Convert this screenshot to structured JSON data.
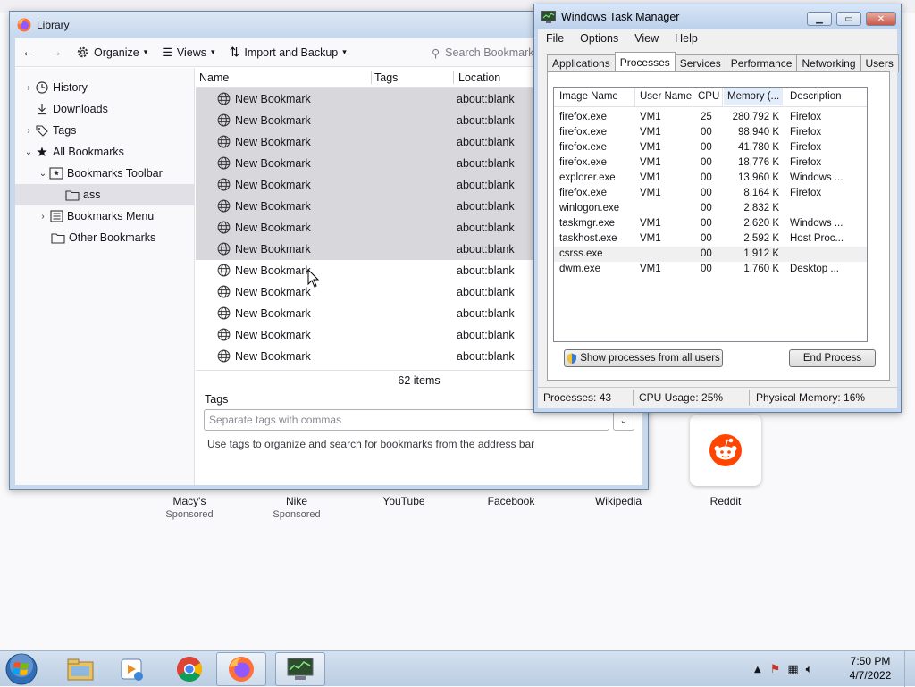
{
  "library": {
    "title": "Library",
    "toolbar": {
      "organize": "Organize",
      "views": "Views",
      "import_backup": "Import and Backup",
      "search_placeholder": "Search Bookmarks"
    },
    "sidebar": [
      {
        "label": "History",
        "twisty": "›",
        "icon": "clock-icon"
      },
      {
        "label": "Downloads",
        "twisty": "",
        "icon": "download-icon"
      },
      {
        "label": "Tags",
        "twisty": "›",
        "icon": "tags-icon"
      },
      {
        "label": "All Bookmarks",
        "twisty": "⌄",
        "icon": "star-icon"
      },
      {
        "label": "Bookmarks Toolbar",
        "twisty": "⌄",
        "icon": "bookmarks-toolbar-icon"
      },
      {
        "label": "ass",
        "twisty": "",
        "icon": "folder-icon"
      },
      {
        "label": "Bookmarks Menu",
        "twisty": "›",
        "icon": "bookmarks-menu-icon"
      },
      {
        "label": "Other Bookmarks",
        "twisty": "",
        "icon": "folder-icon"
      }
    ],
    "columns": {
      "name": "Name",
      "tags": "Tags",
      "location": "Location"
    },
    "bookmarks": [
      {
        "name": "New Bookmark",
        "location": "about:blank",
        "selected": true
      },
      {
        "name": "New Bookmark",
        "location": "about:blank",
        "selected": true
      },
      {
        "name": "New Bookmark",
        "location": "about:blank",
        "selected": true
      },
      {
        "name": "New Bookmark",
        "location": "about:blank",
        "selected": true
      },
      {
        "name": "New Bookmark",
        "location": "about:blank",
        "selected": true
      },
      {
        "name": "New Bookmark",
        "location": "about:blank",
        "selected": true
      },
      {
        "name": "New Bookmark",
        "location": "about:blank",
        "selected": true
      },
      {
        "name": "New Bookmark",
        "location": "about:blank",
        "selected": true
      },
      {
        "name": "New Bookmark",
        "location": "about:blank",
        "selected": false
      },
      {
        "name": "New Bookmark",
        "location": "about:blank",
        "selected": false
      },
      {
        "name": "New Bookmark",
        "location": "about:blank",
        "selected": false
      },
      {
        "name": "New Bookmark",
        "location": "about:blank",
        "selected": false
      },
      {
        "name": "New Bookmark",
        "location": "about:blank",
        "selected": false
      }
    ],
    "items_count": "62 items",
    "tags_label": "Tags",
    "tags_placeholder": "Separate tags with commas",
    "tags_hint": "Use tags to organize and search for bookmarks from the address bar"
  },
  "newtab": {
    "shortcuts": [
      {
        "label": "Macy's",
        "sub": "Sponsored"
      },
      {
        "label": "Nike",
        "sub": "Sponsored"
      },
      {
        "label": "YouTube",
        "sub": ""
      },
      {
        "label": "Facebook",
        "sub": ""
      },
      {
        "label": "Wikipedia",
        "sub": ""
      },
      {
        "label": "Reddit",
        "sub": ""
      }
    ]
  },
  "taskmgr": {
    "title": "Windows Task Manager",
    "menu": [
      "File",
      "Options",
      "View",
      "Help"
    ],
    "tabs": [
      "Applications",
      "Processes",
      "Services",
      "Performance",
      "Networking",
      "Users"
    ],
    "active_tab": "Processes",
    "columns": [
      "Image Name",
      "User Name",
      "CPU",
      "Memory (...",
      "Description"
    ],
    "processes": [
      {
        "image": "firefox.exe",
        "user": "VM1",
        "cpu": "25",
        "mem": "280,792 K",
        "desc": "Firefox"
      },
      {
        "image": "firefox.exe",
        "user": "VM1",
        "cpu": "00",
        "mem": "98,940 K",
        "desc": "Firefox"
      },
      {
        "image": "firefox.exe",
        "user": "VM1",
        "cpu": "00",
        "mem": "41,780 K",
        "desc": "Firefox"
      },
      {
        "image": "firefox.exe",
        "user": "VM1",
        "cpu": "00",
        "mem": "18,776 K",
        "desc": "Firefox"
      },
      {
        "image": "explorer.exe",
        "user": "VM1",
        "cpu": "00",
        "mem": "13,960 K",
        "desc": "Windows ..."
      },
      {
        "image": "firefox.exe",
        "user": "VM1",
        "cpu": "00",
        "mem": "8,164 K",
        "desc": "Firefox"
      },
      {
        "image": "winlogon.exe",
        "user": "",
        "cpu": "00",
        "mem": "2,832 K",
        "desc": ""
      },
      {
        "image": "taskmgr.exe",
        "user": "VM1",
        "cpu": "00",
        "mem": "2,620 K",
        "desc": "Windows ..."
      },
      {
        "image": "taskhost.exe",
        "user": "VM1",
        "cpu": "00",
        "mem": "2,592 K",
        "desc": "Host Proc..."
      },
      {
        "image": "csrss.exe",
        "user": "",
        "cpu": "00",
        "mem": "1,912 K",
        "desc": ""
      },
      {
        "image": "dwm.exe",
        "user": "VM1",
        "cpu": "00",
        "mem": "1,760 K",
        "desc": "Desktop ..."
      }
    ],
    "selected_process_index": 9,
    "show_all_button": "Show processes from all users",
    "end_process_button": "End Process",
    "status": {
      "processes": "Processes: 43",
      "cpu": "CPU Usage: 25%",
      "memory": "Physical Memory: 16%"
    }
  },
  "taskbar": {
    "time": "7:50 PM",
    "date": "4/7/2022",
    "apps": [
      "explorer-icon",
      "media-player-icon",
      "chrome-icon",
      "firefox-icon",
      "task-manager-icon"
    ]
  },
  "colors": {
    "selection": "#d7d7dc",
    "reddit": "#ff4500",
    "win7_title": "#c4d7ee"
  }
}
